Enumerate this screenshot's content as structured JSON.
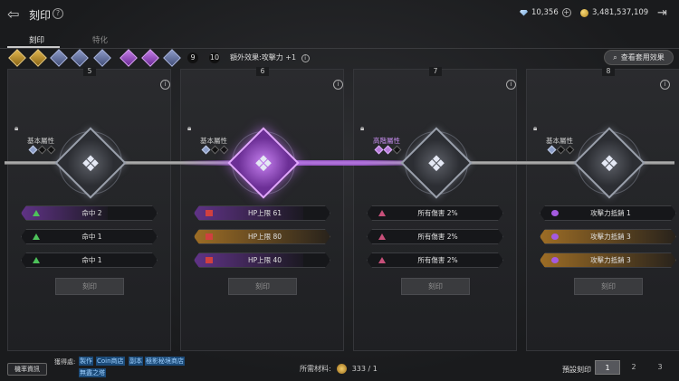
{
  "header": {
    "title": "刻印",
    "currency_gem": "10,356",
    "currency_gold": "3,481,537,109"
  },
  "tabs": [
    {
      "label": "刻印"
    },
    {
      "label": "特化"
    }
  ],
  "slots": {
    "nums": [
      "9",
      "10"
    ]
  },
  "extra_effect": "額外效果:攻擊力 +1",
  "view_set_label": "查看套用效果",
  "panels": [
    {
      "num": "5",
      "attr": "基本屬性",
      "stats": [
        "命中 2",
        "命中 1",
        "命中 1"
      ],
      "engrave": "刻印"
    },
    {
      "num": "6",
      "attr": "基本屬性",
      "stats": [
        "HP上限 61",
        "HP上限 80",
        "HP上限 40"
      ],
      "engrave": "刻印"
    },
    {
      "num": "7",
      "attr": "高階屬性",
      "stats": [
        "所有傷害 2%",
        "所有傷害 2%",
        "所有傷害 2%"
      ],
      "engrave": "刻印"
    },
    {
      "num": "8",
      "attr": "基本屬性",
      "stats": [
        "攻擊力抵銷 1",
        "攻擊力抵銷 3",
        "攻擊力抵銷 3"
      ],
      "engrave": "刻印"
    }
  ],
  "footer": {
    "prob_label": "機率資訊",
    "obtain_label": "獲得處:",
    "links": [
      "製作",
      "Coin商店",
      "副本",
      "極影秘境商店",
      "無盡之塔"
    ],
    "material_label": "所需材料:",
    "material_value": "333 / 1",
    "preset_label": "預設刻印",
    "presets": [
      "1",
      "2",
      "3"
    ]
  },
  "colors": {
    "accent_purple": "#b063e6",
    "accent_gold": "#e2b74c"
  }
}
